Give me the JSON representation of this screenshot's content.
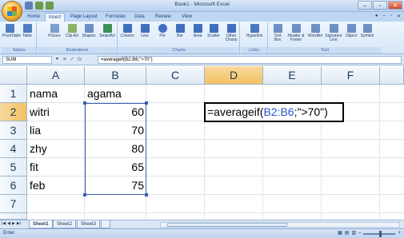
{
  "window": {
    "title": "Book1 - Microsoft Excel",
    "controls": [
      "–",
      "▫",
      "✕"
    ]
  },
  "ribbon_tabs": [
    {
      "label": "Home",
      "active": false
    },
    {
      "label": "Insert",
      "active": true
    },
    {
      "label": "Page Layout",
      "active": false
    },
    {
      "label": "Formulas",
      "active": false
    },
    {
      "label": "Data",
      "active": false
    },
    {
      "label": "Review",
      "active": false
    },
    {
      "label": "View",
      "active": false
    }
  ],
  "ribbon_groups": {
    "tables": {
      "label": "Tables",
      "buttons": [
        {
          "label": "PivotTable",
          "icon": "pivottable-icon",
          "color": "#4f7fc0"
        },
        {
          "label": "Table",
          "icon": "table-icon",
          "color": "#4f7fc0"
        }
      ]
    },
    "illustrations": {
      "label": "Illustrations",
      "buttons": [
        {
          "label": "Picture",
          "icon": "picture-icon",
          "color": "#7b9fcf"
        },
        {
          "label": "Clip Art",
          "icon": "clipart-icon",
          "color": "#8bb26a"
        },
        {
          "label": "Shapes",
          "icon": "shapes-icon",
          "color": "#6d8fc4"
        },
        {
          "label": "SmartArt",
          "icon": "smartart-icon",
          "color": "#3d8f58"
        }
      ]
    },
    "charts": {
      "label": "Charts",
      "buttons": [
        {
          "label": "Column",
          "icon": "column-chart-icon",
          "color": "#3f6fbf"
        },
        {
          "label": "Line",
          "icon": "line-chart-icon",
          "color": "#3f6fbf"
        },
        {
          "label": "Pie",
          "icon": "pie-chart-icon",
          "color": "#3f6fbf"
        },
        {
          "label": "Bar",
          "icon": "bar-chart-icon",
          "color": "#3f6fbf"
        },
        {
          "label": "Area",
          "icon": "area-chart-icon",
          "color": "#3f6fbf"
        },
        {
          "label": "Scatter",
          "icon": "scatter-chart-icon",
          "color": "#3f6fbf"
        },
        {
          "label": "Other Charts",
          "icon": "other-charts-icon",
          "color": "#3f6fbf"
        }
      ]
    },
    "links": {
      "label": "Links",
      "buttons": [
        {
          "label": "Hyperlink",
          "icon": "hyperlink-icon",
          "color": "#4a79c2"
        }
      ]
    },
    "text": {
      "label": "Text",
      "buttons": [
        {
          "label": "Text Box",
          "icon": "textbox-icon",
          "color": "#6d8fc4"
        },
        {
          "label": "Header & Footer",
          "icon": "header-footer-icon",
          "color": "#6d8fc4"
        },
        {
          "label": "WordArt",
          "icon": "wordart-icon",
          "color": "#6d8fc4"
        },
        {
          "label": "Signature Line",
          "icon": "signature-icon",
          "color": "#6d8fc4"
        },
        {
          "label": "Object",
          "icon": "object-icon",
          "color": "#6d8fc4"
        },
        {
          "label": "Symbol",
          "icon": "symbol-icon",
          "color": "#6d8fc4"
        }
      ]
    }
  },
  "formula_bar": {
    "name_box": "SUM",
    "cancel": "✕",
    "enter": "✓",
    "fx": "fx",
    "formula": "=averageif(B2:B6;\">70\")"
  },
  "columns": [
    "A",
    "B",
    "C",
    "D",
    "E",
    "F"
  ],
  "rows": [
    "1",
    "2",
    "3",
    "4",
    "5",
    "6",
    "7"
  ],
  "cells": {
    "A1": "nama",
    "B1": "agama",
    "A2": "witri",
    "B2": "60",
    "A3": "lia",
    "B3": "70",
    "A4": "zhy",
    "B4": "80",
    "A5": "fit",
    "B5": "65",
    "A6": "feb",
    "B6": "75"
  },
  "editing": {
    "prefix": "=averageif(",
    "ref": "B2:B6",
    "suffix": ";\">70\")"
  },
  "sheet_tabs": [
    {
      "label": "Sheet1",
      "active": true
    },
    {
      "label": "Sheet2",
      "active": false
    },
    {
      "label": "Sheet3",
      "active": false
    }
  ],
  "status": {
    "mode": "Enter"
  },
  "colors": {
    "accent": "#15428b",
    "selection_header": "#f1c15f",
    "range_ref": "#2356c8"
  }
}
